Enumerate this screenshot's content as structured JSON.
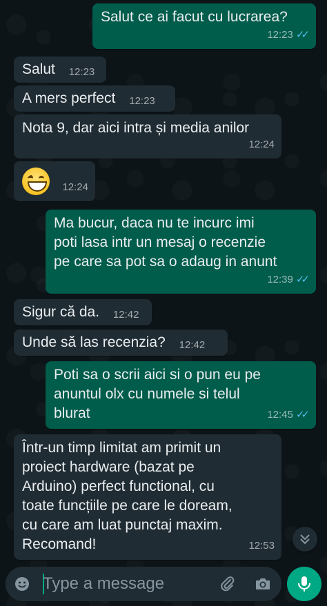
{
  "messages": [
    {
      "dir": "out",
      "text": "Salut ce ai facut cu lucrarea?",
      "time": "12:23",
      "ticks": "read"
    },
    {
      "dir": "in",
      "text": "Salut",
      "time": "12:23"
    },
    {
      "dir": "in",
      "text": "A mers perfect",
      "time": "12:23"
    },
    {
      "dir": "in",
      "text": "Nota 9, dar aici intra și media anilor",
      "time": "12:24"
    },
    {
      "dir": "in",
      "emoji": "grinning-face-with-smiling-eyes",
      "time": "12:24"
    },
    {
      "dir": "out",
      "text": "Ma bucur, daca nu te incurc imi\npoti lasa intr un mesaj o recenzie\npe care sa pot sa o adaug in anunt",
      "time": "12:39",
      "ticks": "read"
    },
    {
      "dir": "in",
      "text": "Sigur că da.",
      "time": "12:42"
    },
    {
      "dir": "in",
      "text": "Unde să las recenzia?",
      "time": "12:42"
    },
    {
      "dir": "out",
      "text": "Poti sa o scrii aici si o pun eu pe\nanuntul olx cu numele si telul\nblurat",
      "time": "12:45",
      "ticks": "read"
    },
    {
      "dir": "in",
      "text": "Într-un timp limitat am primit un\nproiect hardware (bazat pe\nArduino) perfect functional, cu\ntoate funcțiile pe care le doream,\ncu care am luat punctaj maxim.\nRecomand!",
      "time": "12:53"
    }
  ],
  "composer": {
    "placeholder": "Type a message",
    "value": ""
  },
  "icons": {
    "emoji_button": "smiley-icon",
    "attach": "paperclip-icon",
    "camera": "camera-icon",
    "mic": "microphone-icon",
    "scroll_down": "double-chevron-down-icon"
  },
  "colors": {
    "outgoing_bubble": "#005c4b",
    "incoming_bubble": "#202c33",
    "read_ticks": "#53bdeb",
    "accent": "#00a884"
  }
}
